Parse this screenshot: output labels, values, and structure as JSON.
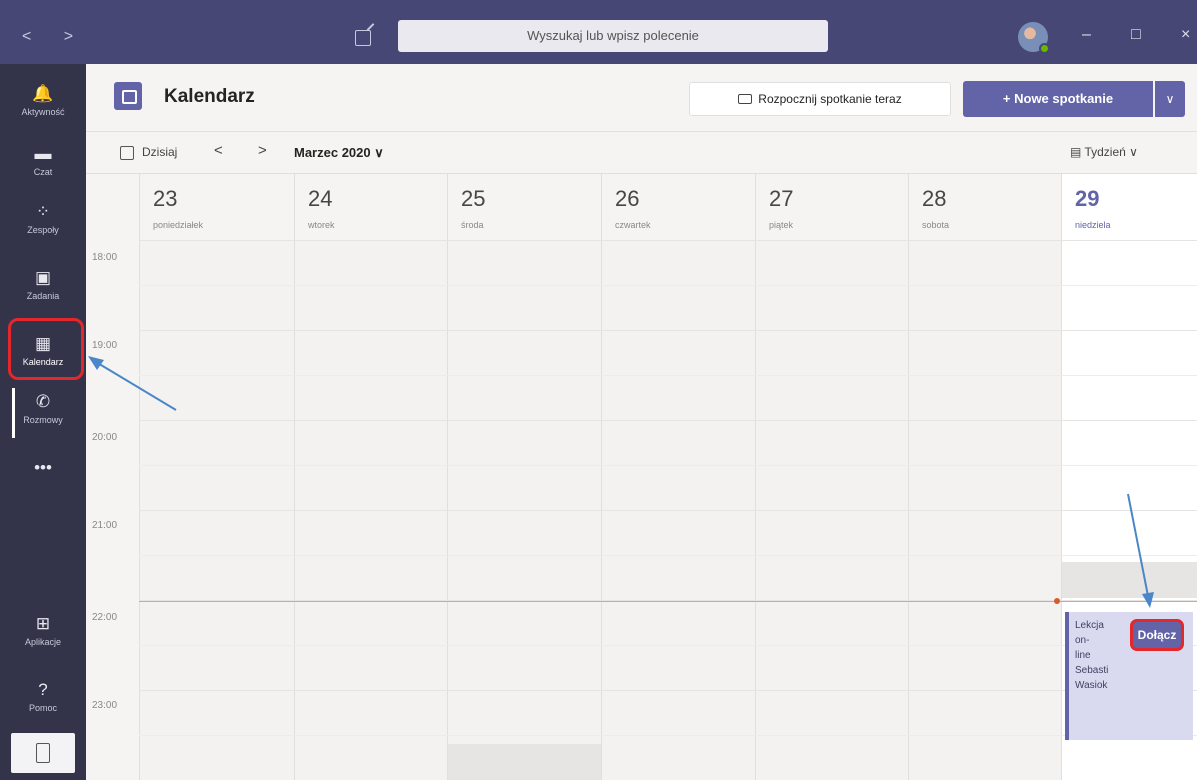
{
  "titlebar": {
    "nav": "< >",
    "search_placeholder": "Wyszukaj lub wpisz polecenie",
    "minimize": "–",
    "maximize": "□",
    "close": "×"
  },
  "rail": {
    "items": [
      {
        "label": "Aktywność",
        "icon": "bell-icon",
        "glyph": "🔔"
      },
      {
        "label": "Czat",
        "icon": "chat-icon",
        "glyph": "▬"
      },
      {
        "label": "Zespoły",
        "icon": "teams-icon",
        "glyph": "⁘"
      },
      {
        "label": "Zadania",
        "icon": "assignments-icon",
        "glyph": "▣"
      },
      {
        "label": "Kalendarz",
        "icon": "calendar-icon",
        "glyph": "▦"
      },
      {
        "label": "Rozmowy",
        "icon": "phone-icon",
        "glyph": "✆"
      },
      {
        "label": "Aplikacje",
        "icon": "apps-icon",
        "glyph": "⊞"
      },
      {
        "label": "Pomoc",
        "icon": "help-icon",
        "glyph": "?"
      }
    ],
    "more": "•••"
  },
  "header": {
    "title": "Kalendarz",
    "meet_now": "Rozpocznij spotkanie teraz",
    "new_meeting": "+ Nowe spotkanie",
    "new_meeting_dropdown": "∨"
  },
  "toolbar": {
    "today": "Dzisiaj",
    "prev": "<",
    "next": ">",
    "month": "Marzec 2020",
    "view": "Tydzień"
  },
  "days": [
    {
      "num": "23",
      "name": "poniedziałek"
    },
    {
      "num": "24",
      "name": "wtorek"
    },
    {
      "num": "25",
      "name": "środa"
    },
    {
      "num": "26",
      "name": "czwartek"
    },
    {
      "num": "27",
      "name": "piątek"
    },
    {
      "num": "28",
      "name": "sobota"
    },
    {
      "num": "29",
      "name": "niedziela"
    }
  ],
  "hours": [
    "18:00",
    "19:00",
    "20:00",
    "21:00",
    "22:00",
    "23:00"
  ],
  "event": {
    "title_lines": [
      "Lekcja",
      "on-",
      "line",
      "Sebasti",
      "Wasiok"
    ],
    "join": "Dołącz"
  },
  "colors": {
    "accent": "#6264a7",
    "titlebar": "#464775",
    "rail": "#33344a",
    "highlight": "#e3272b",
    "annotation_arrow": "#4a86c8"
  }
}
